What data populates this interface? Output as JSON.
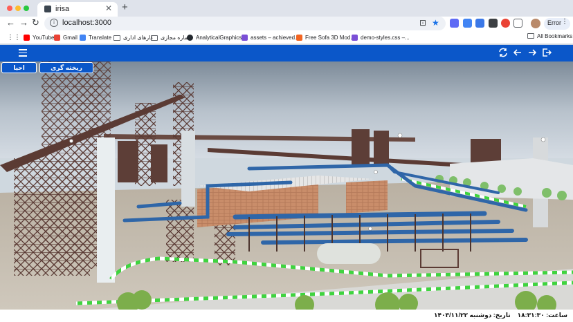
{
  "browser": {
    "tab_title": "irisa",
    "url": "localhost:3000",
    "profile_status": "Error",
    "bookmarks": [
      {
        "label": "YouTube",
        "color": "#ff0000"
      },
      {
        "label": "Gmail",
        "color": "#ea4335"
      },
      {
        "label": "Translate",
        "color": "#4285f4"
      },
      {
        "label": "کارهای اداری",
        "color": "folder"
      },
      {
        "label": "شماره مجازی",
        "color": "folder"
      },
      {
        "label": "AnalyticalGraphics...",
        "color": "#24292f"
      },
      {
        "label": "assets – achieved...",
        "color": "#7b4fd6"
      },
      {
        "label": "Free Sofa 3D Mod...",
        "color": "#f26522"
      },
      {
        "label": "demo-styles.css –...",
        "color": "#7b4fd6"
      }
    ],
    "all_bookmarks": "All Bookmarks"
  },
  "app": {
    "accent": "#0b57c9",
    "buttons": {
      "left": "احیا",
      "right": "ریخته گری"
    },
    "status": {
      "time": "ساعت: ۱۸:۳۱:۳۰",
      "date": "تاریخ: دوشنبه ۱۴۰۳/۱۱/۲۲"
    }
  }
}
